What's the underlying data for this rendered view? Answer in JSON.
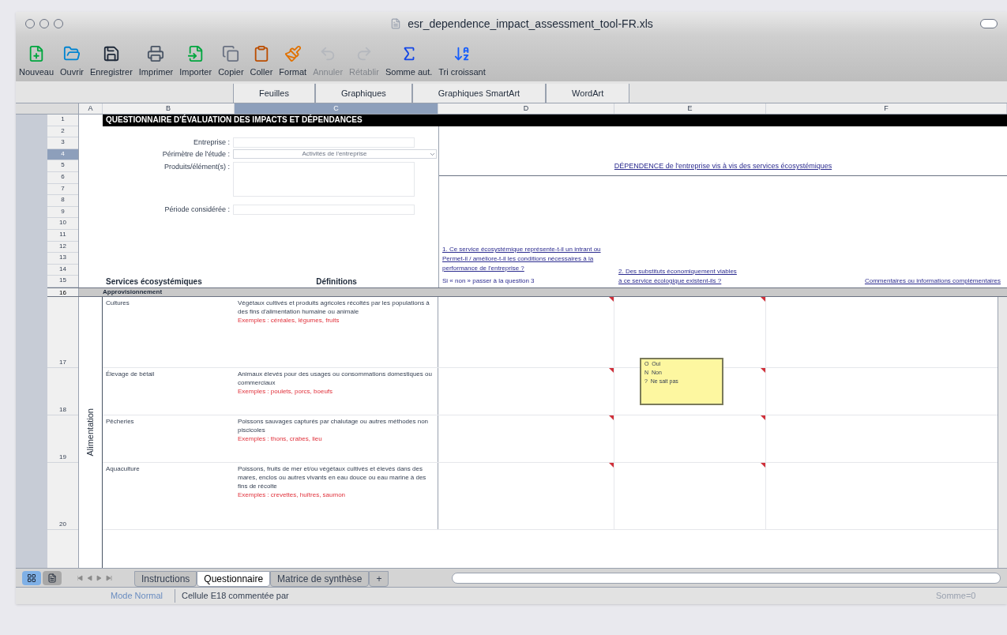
{
  "window": {
    "title": "esr_dependence_impact_assessment_tool-FR.xls"
  },
  "toolbar": [
    {
      "label": "Nouveau",
      "disabled": false
    },
    {
      "label": "Ouvrir",
      "disabled": false
    },
    {
      "label": "Enregistrer",
      "disabled": false
    },
    {
      "label": "Imprimer",
      "disabled": false
    },
    {
      "label": "Importer",
      "disabled": false
    },
    {
      "label": "Copier",
      "disabled": false
    },
    {
      "label": "Coller",
      "disabled": false
    },
    {
      "label": "Format",
      "disabled": false
    },
    {
      "label": "Annuler",
      "disabled": true
    },
    {
      "label": "Rétablir",
      "disabled": true
    },
    {
      "label": "Somme aut.",
      "disabled": false
    },
    {
      "label": "Tri croissant",
      "disabled": false
    }
  ],
  "ribbon_tabs": [
    "Feuilles",
    "Graphiques",
    "Graphiques SmartArt",
    "WordArt"
  ],
  "columns": [
    {
      "label": "A",
      "selected": false
    },
    {
      "label": "B",
      "selected": false
    },
    {
      "label": "C",
      "selected": true
    },
    {
      "label": "D",
      "selected": false
    },
    {
      "label": "E",
      "selected": false
    },
    {
      "label": "F",
      "selected": false
    }
  ],
  "row_numbers": [
    {
      "label": "1",
      "selected": false
    },
    {
      "label": "2",
      "selected": false
    },
    {
      "label": "3",
      "selected": false
    },
    {
      "label": "4",
      "selected": true
    },
    {
      "label": "5",
      "selected": false
    },
    {
      "label": "6",
      "selected": false
    },
    {
      "label": "7",
      "selected": false
    },
    {
      "label": "8",
      "selected": false
    },
    {
      "label": "9",
      "selected": false
    },
    {
      "label": "10",
      "selected": false
    },
    {
      "label": "11",
      "selected": false
    },
    {
      "label": "12",
      "selected": false
    },
    {
      "label": "13",
      "selected": false
    },
    {
      "label": "14",
      "selected": false
    },
    {
      "label": "15",
      "selected": false
    }
  ],
  "sheet": {
    "banner": "QUESTIONNAIRE D'ÉVALUATION DES IMPACTS ET DÉPENDANCES",
    "form": [
      {
        "label": "Entreprise :",
        "kind": "text"
      },
      {
        "label": "Périmètre de l'étude :",
        "kind": "dropdown",
        "value": "Activités de l'entreprise"
      },
      {
        "label": "Produits/élément(s) :",
        "kind": "area"
      },
      {
        "label": "Période considérée :",
        "kind": "text"
      }
    ],
    "dependence_heading": "DÉPENDENCE de l'entreprise vis à vis des services écosystémiques",
    "question_1": "1. Ce service écosystémique représente-t-il un intrant ou Permet-il / améliore-t-il les conditions nécessaires à la performance de l'entreprise ?",
    "question_1_note": "Si « non » passer à la question 3",
    "question_2": "2. Des substituts économiquement viables à ce service écologique existent-ils ?",
    "comments_heading": "Commentaires ou informations complémentaires",
    "services_heading": "Services écosystémiques",
    "definitions_heading": "Définitions",
    "category": {
      "row": "16",
      "label": "Approvisionnement"
    },
    "group_label": "Alimentation",
    "rows": [
      {
        "row": "17",
        "service": "Cultures",
        "definition": "Végétaux cultivés et produits agricoles récoltés par les populations à des fins d'alimentation humaine ou animale",
        "examples": "Exemples : céréales, légumes, fruits"
      },
      {
        "row": "18",
        "service": "Élevage de bétail",
        "definition": "Animaux élevés pour des usages ou consommations domestiques ou commerciaux",
        "examples": "Exemples : poulets, porcs, boeufs"
      },
      {
        "row": "19",
        "service": "Pêcheries",
        "definition": "Poissons sauvages capturés par chalutage ou autres méthodes non piscicoles",
        "examples": "Exemples : thons, crabes, lieu"
      },
      {
        "row": "20",
        "service": "Aquaculture",
        "definition": "Poissons, fruits de mer et/ou végétaux cultivés et élevés dans des mares, enclos ou autres vivants en eau douce ou eau marine à des fins de récolte",
        "examples": "Exemples : crevettes, huîtres, saumon"
      }
    ],
    "comment_popup": [
      "O  Oui",
      "N  Non",
      "?  Ne sait pas"
    ]
  },
  "sheet_tabs": [
    {
      "label": "Instructions",
      "selected": false
    },
    {
      "label": "Questionnaire",
      "selected": true
    },
    {
      "label": "Matrice de synthèse",
      "selected": false
    },
    {
      "label": "+",
      "selected": false
    }
  ],
  "view_buttons": [
    {
      "selected": true
    },
    {
      "selected": false
    }
  ],
  "status_bar": {
    "mode": "Mode Normal",
    "message": "Cellule E18 commentée par",
    "sum": "Somme=0"
  }
}
